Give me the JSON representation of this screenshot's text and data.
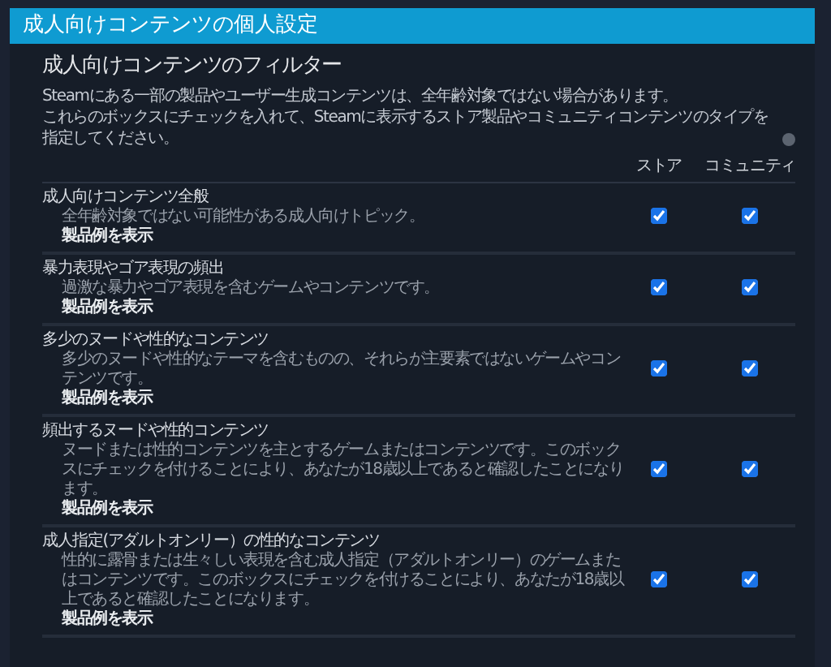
{
  "header": {
    "title": "成人向けコンテンツの個人設定"
  },
  "filter": {
    "title": "成人向けコンテンツのフィルター",
    "intro": [
      "Steamにある一部の製品やユーザー生成コンテンツは、全年齢対象ではない場合があります。",
      "これらのボックスにチェックを入れて、Steamに表示するストア製品やコミュニティコンテンツのタイプを指定してください。"
    ],
    "columns": [
      "ストア",
      "コミュニティ"
    ],
    "rows": [
      {
        "title": "成人向けコンテンツ全般",
        "description": "全年齢対象ではない可能性がある成人向けトピック。",
        "link": "製品例を表示",
        "store_checked": true,
        "community_checked": true
      },
      {
        "title": "暴力表現やゴア表現の頻出",
        "description": "過激な暴力やゴア表現を含むゲームやコンテンツです。",
        "link": "製品例を表示",
        "store_checked": true,
        "community_checked": true
      },
      {
        "title": "多少のヌードや性的なコンテンツ",
        "description": "多少のヌードや性的なテーマを含むものの、それらが主要素ではないゲームやコンテンツです。",
        "link": "製品例を表示",
        "store_checked": true,
        "community_checked": true
      },
      {
        "title": "頻出するヌードや性的コンテンツ",
        "description": "ヌードまたは性的コンテンツを主とするゲームまたはコンテンツです。このボックスにチェックを付けることにより、あなたが18歳以上であると確認したことになります。",
        "link": "製品例を表示",
        "store_checked": true,
        "community_checked": true
      },
      {
        "title": "成人指定(アダルトオンリー）の性的なコンテンツ",
        "description": "性的に露骨または生々しい表現を含む成人指定（アダルトオンリー）のゲームまたはコンテンツです。このボックスにチェックを付けることにより、あなたが18歳以上であると確認したことになります。",
        "link": "製品例を表示",
        "store_checked": true,
        "community_checked": true
      }
    ]
  }
}
